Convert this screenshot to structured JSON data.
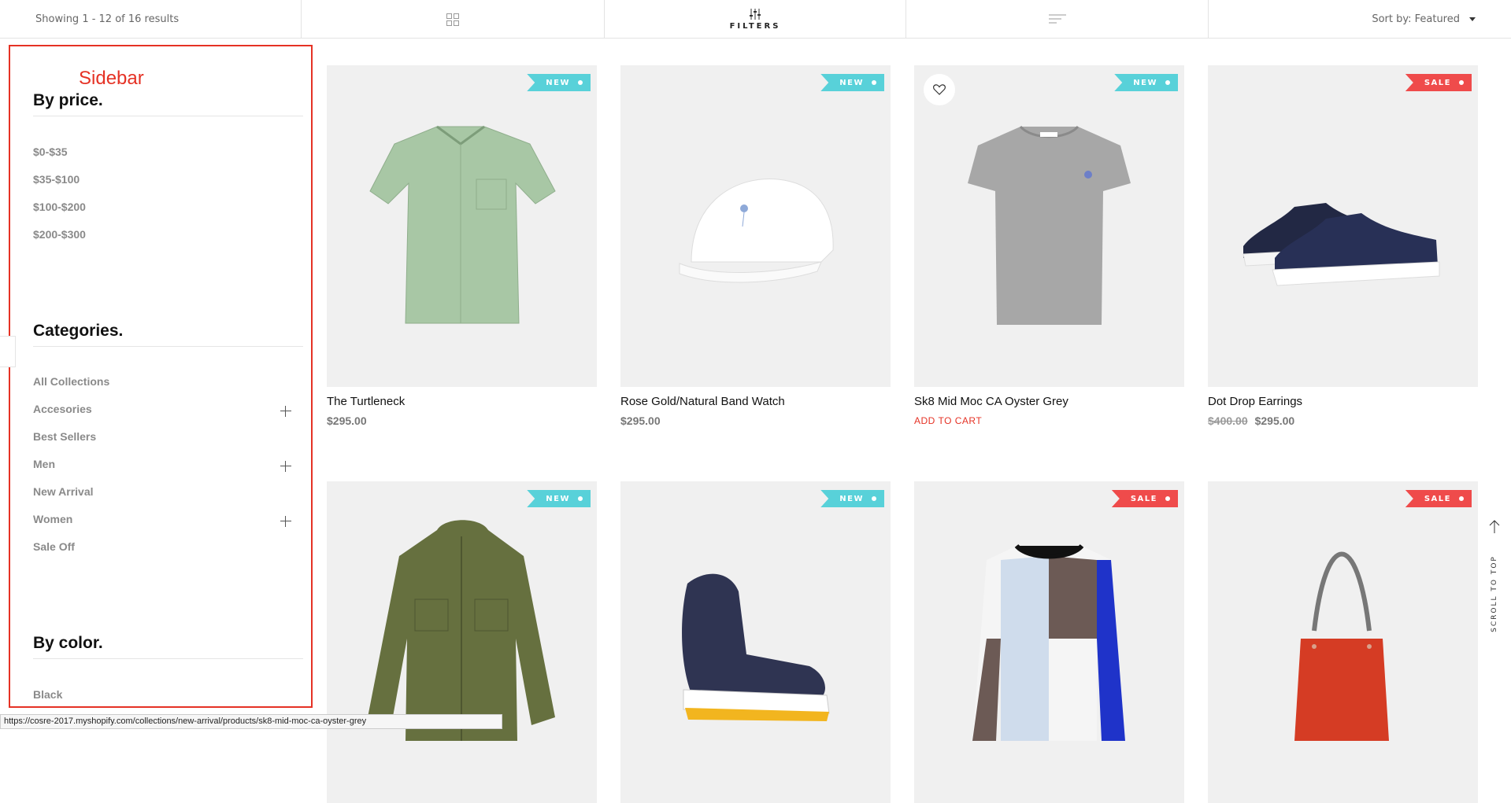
{
  "toolbar": {
    "results_text": "Showing 1 - 12 of 16 results",
    "filters_label": "FILTERS",
    "sort_text": "Sort by: Featured",
    "icons": [
      "grid-icon",
      "sliders-icon",
      "list-icon",
      "caret-down-icon"
    ]
  },
  "sidebar": {
    "annotation": "Sidebar",
    "price_heading": "By price.",
    "price_ranges": [
      "$0-$35",
      "$35-$100",
      "$100-$200",
      "$200-$300"
    ],
    "categories_heading": "Categories.",
    "categories": [
      "All Collections",
      "Accesories",
      "Best Sellers",
      "Men",
      "New Arrival",
      "Women",
      "Sale Off"
    ],
    "expandable": [
      "Accesories",
      "Men",
      "Women"
    ],
    "color_heading": "By color.",
    "colors": [
      "Black"
    ]
  },
  "products": [
    {
      "name": "The Turtleneck",
      "price": "$295.00",
      "old_price": "",
      "badge": "NEW",
      "action": ""
    },
    {
      "name": "Rose Gold/Natural Band Watch",
      "price": "$295.00",
      "old_price": "",
      "badge": "NEW",
      "action": ""
    },
    {
      "name": "Sk8 Mid Moc CA Oyster Grey",
      "price": "",
      "old_price": "",
      "badge": "NEW",
      "action": "ADD TO CART"
    },
    {
      "name": "Dot Drop Earrings",
      "price": "$295.00",
      "old_price": "$400.00",
      "badge": "SALE",
      "action": ""
    },
    {
      "name": "",
      "price": "",
      "old_price": "",
      "badge": "NEW",
      "action": ""
    },
    {
      "name": "",
      "price": "",
      "old_price": "",
      "badge": "NEW",
      "action": ""
    },
    {
      "name": "",
      "price": "",
      "old_price": "",
      "badge": "SALE",
      "action": ""
    },
    {
      "name": "",
      "price": "",
      "old_price": "",
      "badge": "SALE",
      "action": ""
    }
  ],
  "scroll_top_label": "SCROLL TO TOP",
  "status_url": "https://cosre-2017.myshopify.com/collections/new-arrival/products/sk8-mid-moc-ca-oyster-grey",
  "colors": {
    "accent": "#e53225",
    "badge_new": "#58d1d9",
    "badge_sale": "#ef4b4b"
  }
}
